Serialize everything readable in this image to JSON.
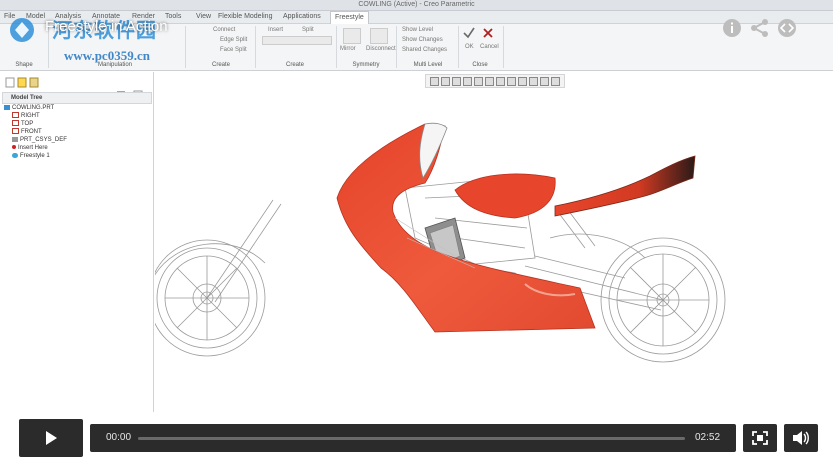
{
  "window": {
    "title": "COWLING (Active) - Creo Parametric"
  },
  "ribbon": {
    "tabs": [
      "File",
      "Model",
      "Analysis",
      "Annotate",
      "Render",
      "Tools",
      "View",
      "Flexible Modeling",
      "Applications",
      "Freestyle"
    ],
    "active_tab": "Freestyle",
    "groups": [
      "Shape",
      "Manipulation",
      "Create",
      "Create",
      "Symmetry",
      "Multi Level",
      "Close"
    ],
    "create_items": [
      "Connect",
      "Edge Split",
      "Face Split"
    ],
    "split_labels": [
      "Insert",
      "Split"
    ],
    "symmetry_items": [
      "Mirror",
      "Disconnect"
    ],
    "multilevel_items": [
      "Show Level",
      "Show Changes",
      "Shared Changes"
    ],
    "close_ok": "OK",
    "close_cancel": "Cancel"
  },
  "video": {
    "title": "Freestyle in Action",
    "current_time": "00:00",
    "duration": "02:52",
    "progress": 0.0
  },
  "watermark": {
    "line1": "河东软件园",
    "line2": "www.pc0359.cn"
  },
  "model_tree": {
    "header": "Model Tree",
    "items": [
      {
        "label": "COWLING.PRT",
        "icon": "part-icon",
        "color": "#3a8fd0"
      },
      {
        "label": "RIGHT",
        "icon": "datum-plane-icon",
        "color": "#c0392b"
      },
      {
        "label": "TOP",
        "icon": "datum-plane-icon",
        "color": "#c0392b"
      },
      {
        "label": "FRONT",
        "icon": "datum-plane-icon",
        "color": "#c0392b"
      },
      {
        "label": "PRT_CSYS_DEF",
        "icon": "csys-icon",
        "color": "#888888"
      },
      {
        "label": "Insert Here",
        "icon": "insert-icon",
        "color": "#d02020"
      },
      {
        "label": "Freestyle 1",
        "icon": "freestyle-icon",
        "color": "#3aa7d8"
      }
    ]
  },
  "colors": {
    "fairing": "#e8462c",
    "control_bg": "#2b2b2b",
    "control_text": "#e6e6e6"
  }
}
